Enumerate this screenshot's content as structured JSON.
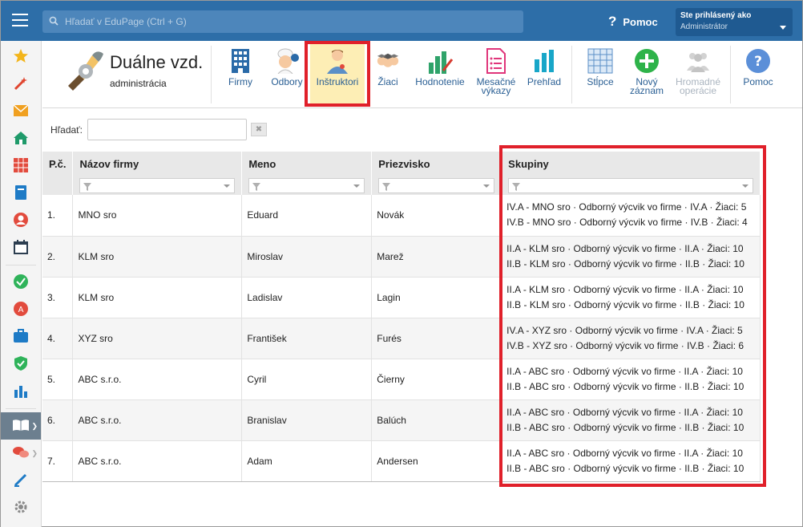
{
  "topbar": {
    "search_placeholder": "Hľadať v EduPage (Ctrl + G)",
    "help_label": "Pomoc",
    "user_line1": "Ste prihlásený ako",
    "user_line2": "Administrátor"
  },
  "module": {
    "title": "Duálne vzd.",
    "subtitle": "administrácia"
  },
  "toolbar": {
    "firmy": "Firmy",
    "odbory": "Odbory",
    "instruktori": "Inštruktori",
    "ziaci": "Žiaci",
    "hodnotenie": "Hodnotenie",
    "mesacne_1": "Mesačné",
    "mesacne_2": "výkazy",
    "prehlad": "Prehľad",
    "stlpce": "Stĺpce",
    "novy_1": "Nový",
    "novy_2": "záznam",
    "hromadne_1": "Hromadné",
    "hromadne_2": "operácie",
    "pomoc": "Pomoc"
  },
  "filter": {
    "label": "Hľadať:",
    "value": ""
  },
  "table": {
    "headers": [
      "P.č.",
      "Názov firmy",
      "Meno",
      "Priezvisko",
      "Skupiny"
    ],
    "rows": [
      {
        "n": "1.",
        "firma": "MNO sro",
        "meno": "Eduard",
        "priezvisko": "Novák",
        "g1": "IV.A - MNO sro · Odborný výcvik vo firme · IV.A · Žiaci: 5",
        "g2": "IV.B - MNO sro · Odborný výcvik vo firme · IV.B · Žiaci: 4"
      },
      {
        "n": "2.",
        "firma": "KLM sro",
        "meno": "Miroslav",
        "priezvisko": "Marež",
        "g1": "II.A - KLM sro · Odborný výcvik vo firme · II.A · Žiaci: 10",
        "g2": "II.B - KLM sro · Odborný výcvik vo firme · II.B · Žiaci: 10"
      },
      {
        "n": "3.",
        "firma": "KLM sro",
        "meno": "Ladislav",
        "priezvisko": "Lagin",
        "g1": "II.A - KLM sro · Odborný výcvik vo firme · II.A · Žiaci: 10",
        "g2": "II.B - KLM sro · Odborný výcvik vo firme · II.B · Žiaci: 10"
      },
      {
        "n": "4.",
        "firma": "XYZ sro",
        "meno": "František",
        "priezvisko": "Furés",
        "g1": "IV.A - XYZ sro · Odborný výcvik vo firme · IV.A · Žiaci: 5",
        "g2": "IV.B - XYZ sro · Odborný výcvik vo firme · IV.B · Žiaci: 6"
      },
      {
        "n": "5.",
        "firma": "ABC s.r.o.",
        "meno": "Cyril",
        "priezvisko": "Čierny",
        "g1": "II.A - ABC sro · Odborný výcvik vo firme · II.A · Žiaci: 10",
        "g2": "II.B - ABC sro · Odborný výcvik vo firme · II.B · Žiaci: 10"
      },
      {
        "n": "6.",
        "firma": "ABC s.r.o.",
        "meno": "Branislav",
        "priezvisko": "Balúch",
        "g1": "II.A - ABC sro · Odborný výcvik vo firme · II.A · Žiaci: 10",
        "g2": "II.B - ABC sro · Odborný výcvik vo firme · II.B · Žiaci: 10"
      },
      {
        "n": "7.",
        "firma": "ABC s.r.o.",
        "meno": "Adam",
        "priezvisko": "Andersen",
        "g1": "II.A - ABC sro · Odborný výcvik vo firme · II.A · Žiaci: 10",
        "g2": "II.B - ABC sro · Odborný výcvik vo firme · II.B · Žiaci: 10"
      }
    ]
  },
  "sidebar": {
    "icons": [
      "star-icon",
      "magic-wand-icon",
      "mail-icon",
      "home-icon",
      "timetable-icon",
      "book-icon",
      "user-icon",
      "calendar-icon",
      "checkmark-icon",
      "badge-icon",
      "briefcase-icon",
      "shield-icon",
      "bar-chart-icon",
      "open-book-icon",
      "chat-icon",
      "pen-icon",
      "gear-icon"
    ]
  },
  "colors": {
    "topbar": "#2d6ea8",
    "highlight": "#e0202a",
    "active_tab": "#fdeeb5",
    "link": "#2a5f94"
  }
}
